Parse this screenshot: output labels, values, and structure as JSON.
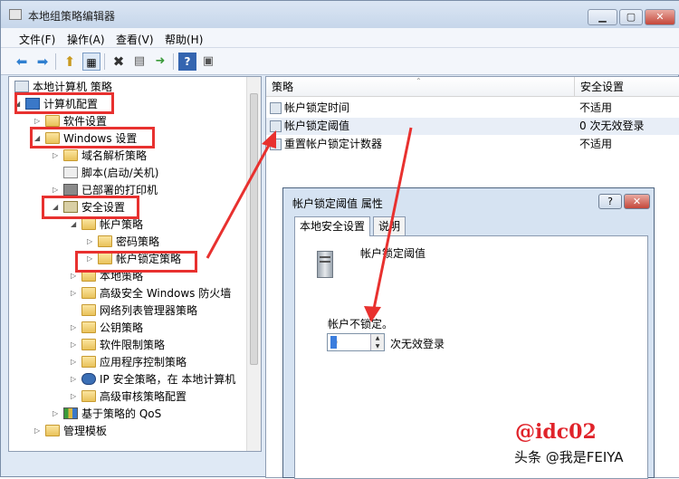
{
  "window": {
    "title": "本地组策略编辑器",
    "controls": [
      "minimize",
      "maximize",
      "close"
    ]
  },
  "menu": [
    "文件(F)",
    "操作(A)",
    "查看(V)",
    "帮助(H)"
  ],
  "toolbar": [
    "back-icon",
    "forward-icon",
    "up-icon",
    "show-hide-tree-icon",
    "delete-icon",
    "properties-icon",
    "export-icon",
    "help-icon",
    "view-icon"
  ],
  "tree": {
    "root": "本地计算机 策略",
    "computer_config": "计算机配置",
    "software_settings": "软件设置",
    "windows_settings": "Windows 设置",
    "name_resolution": "域名解析策略",
    "scripts": "脚本(启动/关机)",
    "deployed_printers": "已部署的打印机",
    "security_settings": "安全设置",
    "account_policies": "帐户策略",
    "password_policy": "密码策略",
    "account_lockout_policy": "帐户锁定策略",
    "local_policies": "本地策略",
    "firewall": "高级安全 Windows 防火墙",
    "network_list": "网络列表管理器策略",
    "public_key": "公钥策略",
    "software_restriction": "软件限制策略",
    "app_control": "应用程序控制策略",
    "ip_security": "IP 安全策略，在 本地计算机",
    "audit_policy": "高级审核策略配置",
    "qos": "基于策略的 QoS",
    "admin_templates": "管理模板"
  },
  "list": {
    "columns": [
      "策略",
      "安全设置"
    ],
    "rows": [
      {
        "policy": "帐户锁定时间",
        "setting": "不适用"
      },
      {
        "policy": "帐户锁定阈值",
        "setting": "0 次无效登录"
      },
      {
        "policy": "重置帐户锁定计数器",
        "setting": "不适用"
      }
    ]
  },
  "dialog": {
    "title": "帐户锁定阈值 属性",
    "help_button": "?",
    "close_button": "✕",
    "tabs": [
      "本地安全设置",
      "说明"
    ],
    "policy_name": "帐户锁定阈值",
    "unlock_label": "帐户不锁定。",
    "value": "0",
    "suffix": "次无效登录"
  },
  "watermark": "@idc02",
  "credit": "头条 @我是FEIYA",
  "colors": {
    "annotation": "#e8312f",
    "watermark": "#e0232a"
  }
}
